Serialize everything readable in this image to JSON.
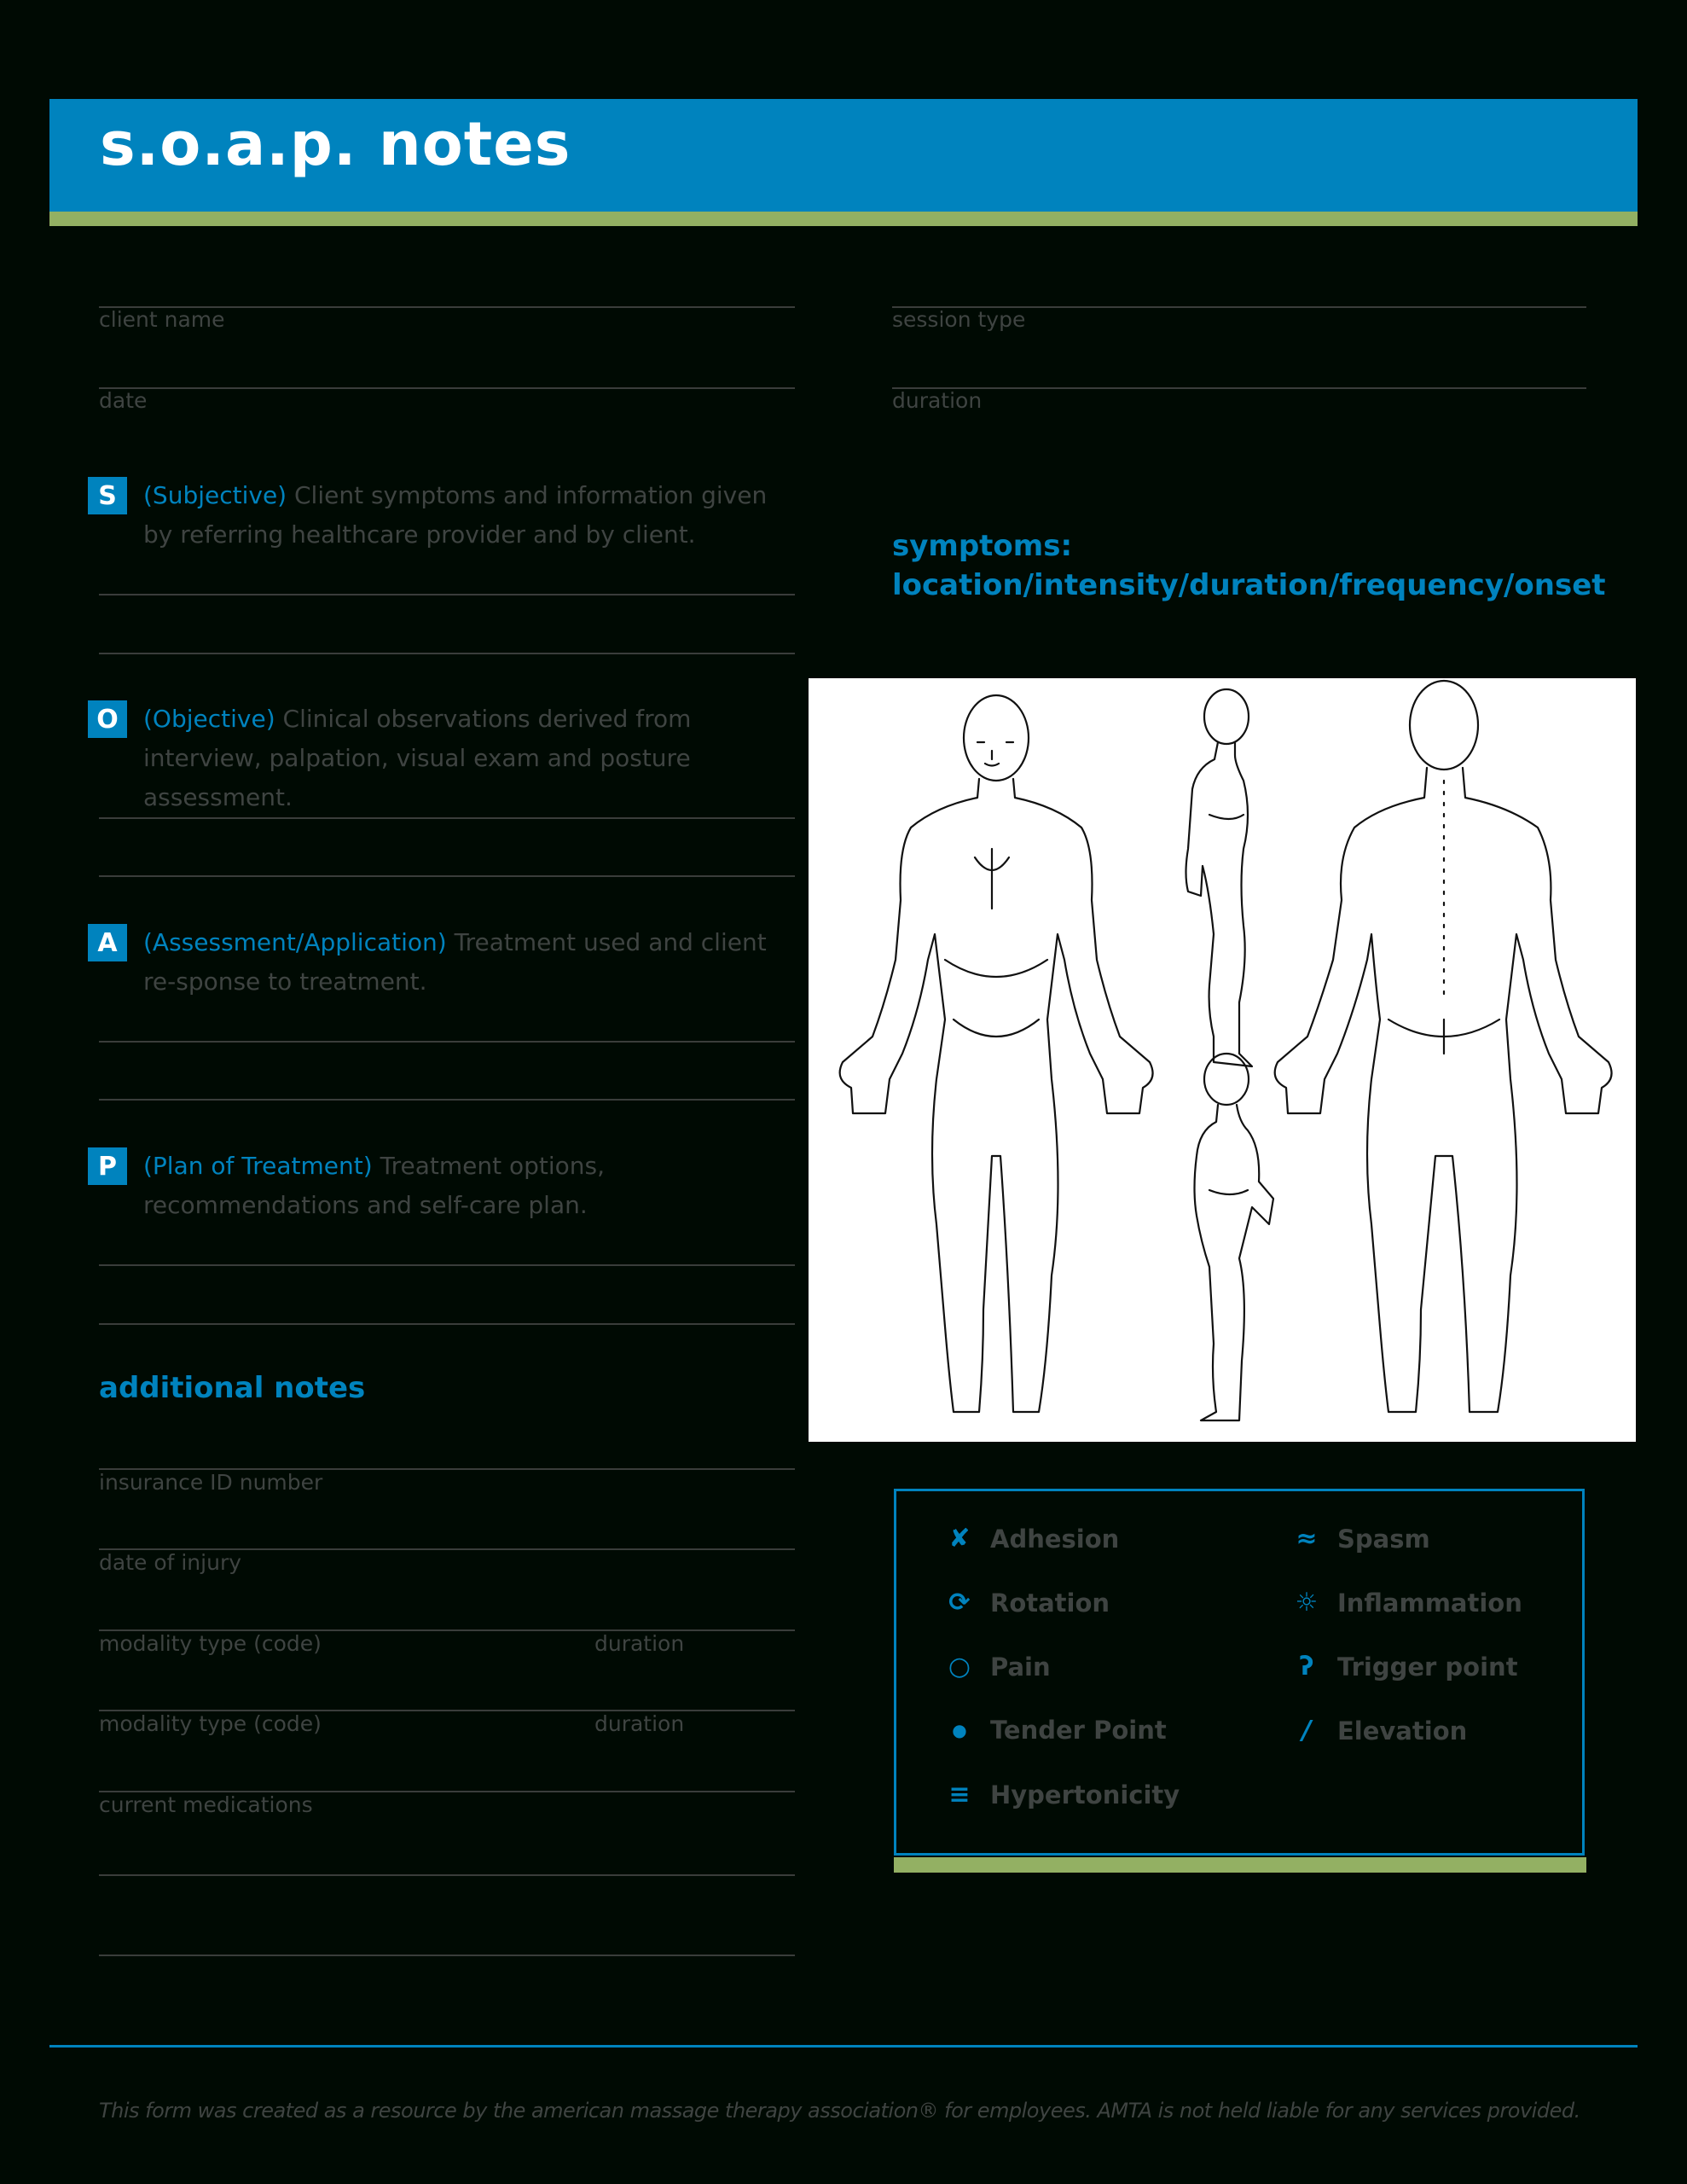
{
  "header": {
    "title": "s.o.a.p. notes"
  },
  "top_fields": {
    "left": [
      {
        "label": "client name"
      },
      {
        "label": "date"
      }
    ],
    "right": [
      {
        "label": "session type"
      },
      {
        "label": "duration"
      }
    ]
  },
  "soap": [
    {
      "letter": "S",
      "term": "(Subjective)",
      "description": " Client symptoms and information given by referring healthcare provider and by client."
    },
    {
      "letter": "O",
      "term": "(Objective)",
      "description": " Clinical observations derived from interview, palpation, visual exam and posture assessment."
    },
    {
      "letter": "A",
      "term": "(Assessment/Application)",
      "description": " Treatment used and client re-sponse to treatment."
    },
    {
      "letter": "P",
      "term": "(Plan of Treatment)",
      "description": " Treatment options, recommendations and self-care plan."
    }
  ],
  "additional": {
    "heading": "additional notes",
    "fields": [
      {
        "label": "insurance ID number"
      },
      {
        "label": "date of injury"
      },
      {
        "label": "modality type (code)",
        "secondary": "duration"
      },
      {
        "label": "modality type (code)",
        "secondary": "duration"
      },
      {
        "label": "current medications"
      }
    ]
  },
  "symptoms": {
    "line1": "symptoms:",
    "line2": "location/intensity/duration/frequency/onset"
  },
  "body_diagram": {
    "views": [
      "front",
      "side-right",
      "side-left",
      "back"
    ]
  },
  "legend": {
    "items": [
      {
        "icon": "x-mark-icon",
        "glyph": "✘",
        "label": "Adhesion"
      },
      {
        "icon": "rotation-icon",
        "glyph": "⟳",
        "label": "Rotation"
      },
      {
        "icon": "circle-icon",
        "glyph": "○",
        "label": "Pain"
      },
      {
        "icon": "dot-icon",
        "glyph": "●",
        "label": "Tender Point"
      },
      {
        "icon": "triple-bar-icon",
        "glyph": "≡",
        "label": "Hypertonicity"
      },
      {
        "icon": "wave-icon",
        "glyph": "≈",
        "label": "Spasm"
      },
      {
        "icon": "sun-icon",
        "glyph": "☼",
        "label": "Inflammation"
      },
      {
        "icon": "hook-icon",
        "glyph": "ʔ",
        "label": "Trigger point"
      },
      {
        "icon": "slash-icon",
        "glyph": "/",
        "label": "Elevation"
      }
    ]
  },
  "footer": {
    "text": "This form was created as a resource by the american massage therapy association® for employees. AMTA is not held liable for any services provided."
  },
  "colors": {
    "accent": "#0083be",
    "band": "#93b063",
    "background": "#000a03",
    "text": "#3f4442"
  }
}
